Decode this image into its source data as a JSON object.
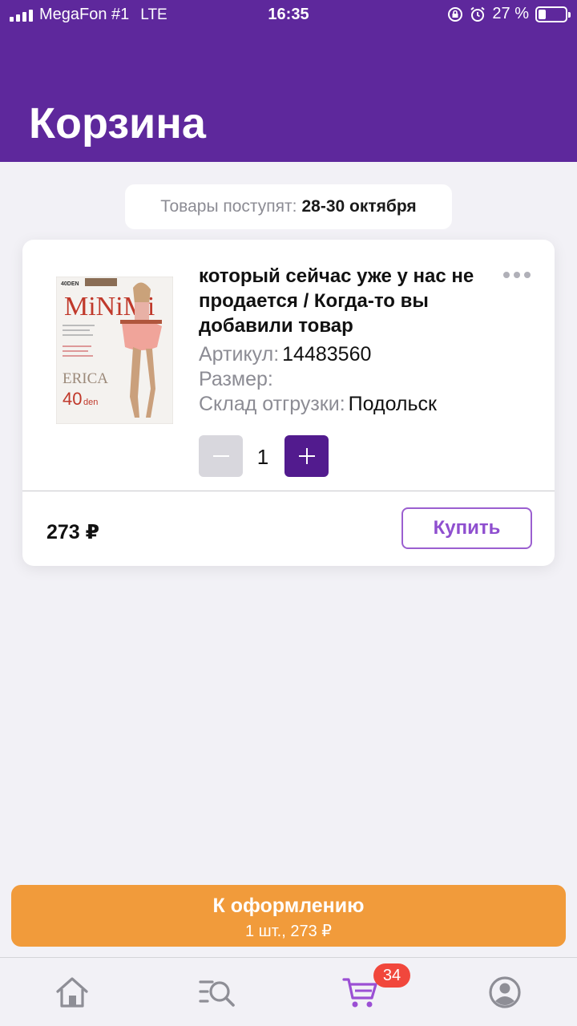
{
  "status_bar": {
    "carrier": "MegaFon #1",
    "network": "LTE",
    "time": "16:35",
    "battery_text": "27 %",
    "battery_level": 0.27,
    "icons": [
      "signal-icon",
      "rotation-lock-icon",
      "alarm-icon",
      "battery-icon"
    ]
  },
  "header": {
    "title": "Корзина"
  },
  "delivery": {
    "label": "Товары поступят:",
    "dates": "28-30 октября"
  },
  "cart_item": {
    "title": "который сейчас уже у нас не продается / Когда-то вы добавили товар",
    "article_label": "Артикул:",
    "article_value": "14483560",
    "size_label": "Размер:",
    "size_value": "",
    "warehouse_label": "Склад отгрузки:",
    "warehouse_value": "Подольск",
    "quantity": "1",
    "price": "273 ₽",
    "buy_label": "Купить",
    "image": {
      "brand": "MiNiMi",
      "model": "ERICA",
      "density": "40",
      "density_unit": "den",
      "top_label": "40DEN"
    }
  },
  "checkout": {
    "label": "К оформлению",
    "summary": "1 шт., 273 ₽"
  },
  "tabbar": {
    "items": [
      {
        "name": "home",
        "icon": "home-icon"
      },
      {
        "name": "catalog",
        "icon": "catalog-search-icon"
      },
      {
        "name": "cart",
        "icon": "cart-icon",
        "badge": "34"
      },
      {
        "name": "profile",
        "icon": "profile-icon"
      }
    ]
  },
  "colors": {
    "header_bg": "#5e289c",
    "accent_purple": "#521b8e",
    "buy_border": "#9b5fd0",
    "checkout_orange": "#f19b3b",
    "badge_red": "#f1473c",
    "page_bg": "#f2f1f6"
  }
}
